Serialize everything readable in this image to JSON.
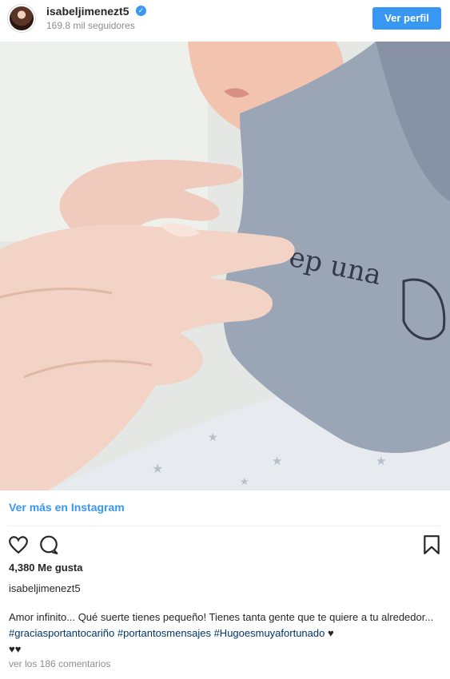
{
  "header": {
    "username": "isabeljimenezt5",
    "followers": "169.8 mil seguidores",
    "view_profile_label": "Ver perfil"
  },
  "photo": {
    "description_icon": "baby-hand-photo"
  },
  "links": {
    "view_more": "Ver más en Instagram"
  },
  "actions": {
    "icons": [
      "heart-icon",
      "comment-icon",
      "bookmark-icon"
    ]
  },
  "stats": {
    "likes": "4,380 Me gusta"
  },
  "caption": {
    "username": "isabeljimenezt5",
    "text_start": "Amor infinito... Qué suerte tienes pequeño! Tienes tanta gente que te quiere a tu alrededor... ",
    "hashtag_1": "#graciasportantocariño",
    "hashtag_2": "#portantosmensajes",
    "hashtag_3": "#Hugoesmuyafortunado",
    "hearts_1": "♥",
    "hearts_2": "♥♥"
  },
  "comments": {
    "label": "ver los 186 comentarios"
  },
  "colors": {
    "accent": "#3897f0",
    "hashtag": "#003569",
    "text": "#262626",
    "muted": "#8e8e8e"
  }
}
